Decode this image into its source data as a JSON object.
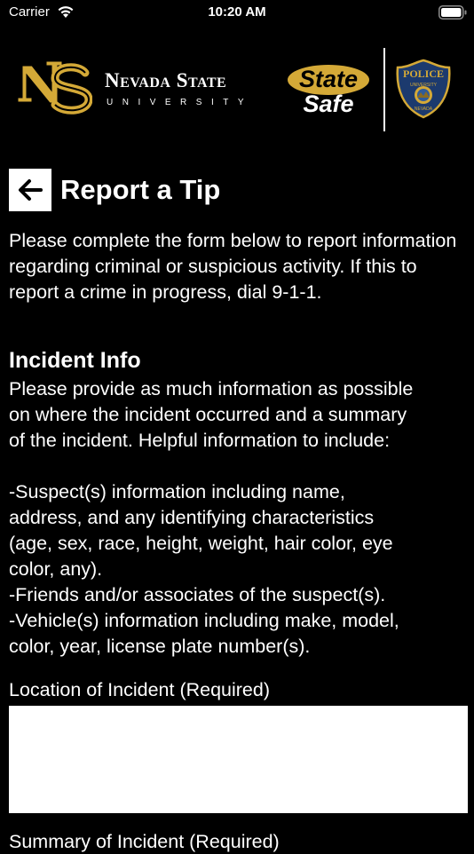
{
  "status_bar": {
    "carrier": "Carrier",
    "time": "10:20 AM"
  },
  "header": {
    "university_name": "Nevada State",
    "university_sub": "UNIVERSITY",
    "statesafe_line1": "State",
    "statesafe_line2": "Safe",
    "police_badge_top": "POLICE",
    "police_badge_mid": "UNIVERSITY",
    "police_badge_bottom": "NEVADA"
  },
  "page": {
    "title": "Report a Tip",
    "intro": "Please complete the form below to report information regarding criminal or suspicious activity. If this to report a crime in progress, dial 9-1-1."
  },
  "incident_info": {
    "heading": "Incident Info",
    "lines": [
      "Please provide as much information as possible",
      "on where the incident occurred and a summary",
      "of the incident.  Helpful information to include:",
      "",
      "-Suspect(s) information including name,",
      "address, and any identifying characteristics",
      "(age, sex, race, height, weight, hair color, eye",
      "color, any).",
      "-Friends and/or associates of the suspect(s).",
      "-Vehicle(s) information including make, model,",
      "color, year, license plate number(s)."
    ]
  },
  "form": {
    "location_label": "Location of Incident (Required)",
    "location_value": "",
    "summary_label": "Summary of Incident (Required)"
  },
  "colors": {
    "background": "#000000",
    "gold": "#d4a937",
    "text": "#ffffff",
    "badge_blue": "#1c3a6e"
  }
}
